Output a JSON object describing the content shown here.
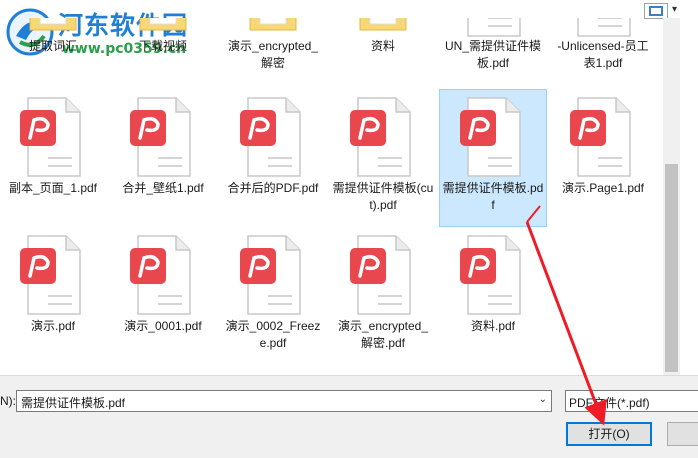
{
  "watermark": {
    "title": "河东软件园",
    "url": "www.pc0359.cn"
  },
  "toolbar": {
    "view_icon": "view-toggle-icon",
    "dropdown_glyph": "▾"
  },
  "files": [
    {
      "label": "提取词汇",
      "type": "folder",
      "partial": true
    },
    {
      "label": "下载视频",
      "type": "folder",
      "partial": true
    },
    {
      "label": "演示_encrypted_解密",
      "type": "folder",
      "partial": true
    },
    {
      "label": "资料",
      "type": "folder",
      "partial": true
    },
    {
      "label": "UN_需提供证件模板.pdf",
      "type": "pdf",
      "partial": true
    },
    {
      "label": "-Unlicensed-员工表1.pdf",
      "type": "pdf",
      "partial": true
    },
    {
      "label": "副本_页面_1.pdf",
      "type": "pdf"
    },
    {
      "label": "合并_壁纸1.pdf",
      "type": "pdf"
    },
    {
      "label": "合并后的PDF.pdf",
      "type": "pdf"
    },
    {
      "label": "需提供证件模板(cut).pdf",
      "type": "pdf"
    },
    {
      "label": "需提供证件模板.pdf",
      "type": "pdf",
      "selected": true
    },
    {
      "label": "演示.Page1.pdf",
      "type": "pdf"
    },
    {
      "label": "演示.pdf",
      "type": "pdf"
    },
    {
      "label": "演示_0001.pdf",
      "type": "pdf"
    },
    {
      "label": "演示_0002_Freeze.pdf",
      "type": "pdf"
    },
    {
      "label": "演示_encrypted_解密.pdf",
      "type": "pdf"
    },
    {
      "label": "资料.pdf",
      "type": "pdf"
    }
  ],
  "bottom": {
    "filename_label": "N):",
    "filename_value": "需提供证件模板.pdf",
    "filetype_value": "PDF文件(*.pdf)",
    "open_label": "打开(O)",
    "dropdown_glyph": "⌄"
  },
  "colors": {
    "pdf_badge": "#e8474d",
    "selection": "#cce8ff",
    "annotation_arrow": "#ee1c25",
    "folder": "#f8d775"
  }
}
